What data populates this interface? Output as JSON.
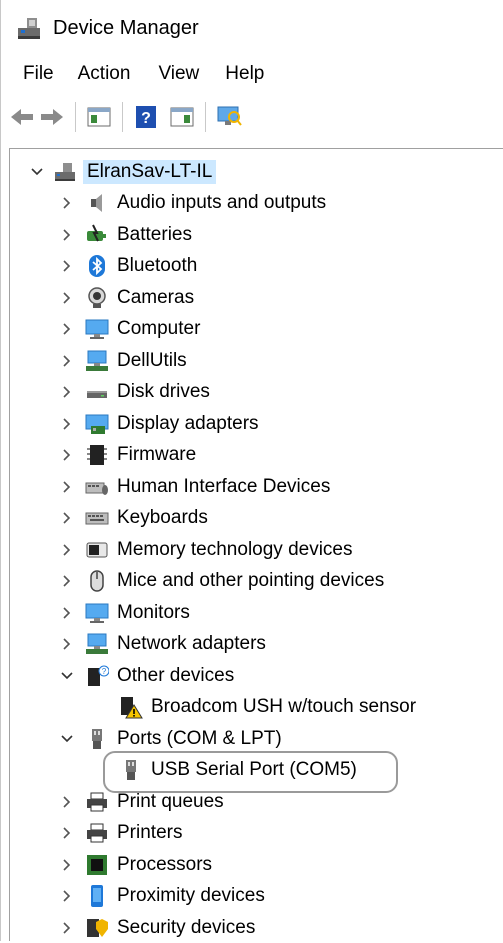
{
  "window": {
    "title": "Device Manager"
  },
  "menu": [
    "File",
    "Action",
    "View",
    "Help"
  ],
  "tree": {
    "root": "ElranSav-LT-IL",
    "categories": [
      {
        "label": "Audio inputs and outputs",
        "icon": "speaker-icon"
      },
      {
        "label": "Batteries",
        "icon": "battery-icon"
      },
      {
        "label": "Bluetooth",
        "icon": "bluetooth-icon"
      },
      {
        "label": "Cameras",
        "icon": "camera-icon"
      },
      {
        "label": "Computer",
        "icon": "computer-icon"
      },
      {
        "label": "DellUtils",
        "icon": "monitor-network-icon"
      },
      {
        "label": "Disk drives",
        "icon": "disk-drive-icon"
      },
      {
        "label": "Display adapters",
        "icon": "display-adapter-icon"
      },
      {
        "label": "Firmware",
        "icon": "firmware-icon"
      },
      {
        "label": "Human Interface Devices",
        "icon": "hid-icon"
      },
      {
        "label": "Keyboards",
        "icon": "keyboard-icon"
      },
      {
        "label": "Memory technology devices",
        "icon": "memory-icon"
      },
      {
        "label": "Mice and other pointing devices",
        "icon": "mouse-icon"
      },
      {
        "label": "Monitors",
        "icon": "monitor-icon"
      },
      {
        "label": "Network adapters",
        "icon": "network-adapter-icon"
      },
      {
        "label": "Other devices",
        "icon": "unknown-device-icon",
        "expanded": true,
        "children": [
          {
            "label": "Broadcom USH w/touch sensor",
            "icon": "warning-device-icon"
          }
        ]
      },
      {
        "label": "Ports (COM & LPT)",
        "icon": "port-icon",
        "expanded": true,
        "children": [
          {
            "label": "USB Serial Port (COM5)",
            "icon": "port-icon"
          }
        ]
      },
      {
        "label": "Print queues",
        "icon": "printer-icon"
      },
      {
        "label": "Printers",
        "icon": "printer-icon"
      },
      {
        "label": "Processors",
        "icon": "processor-icon"
      },
      {
        "label": "Proximity devices",
        "icon": "proximity-icon"
      },
      {
        "label": "Security devices",
        "icon": "security-icon"
      }
    ]
  },
  "colors": {
    "selection": "#cce8ff",
    "accent": "#0078d7"
  }
}
